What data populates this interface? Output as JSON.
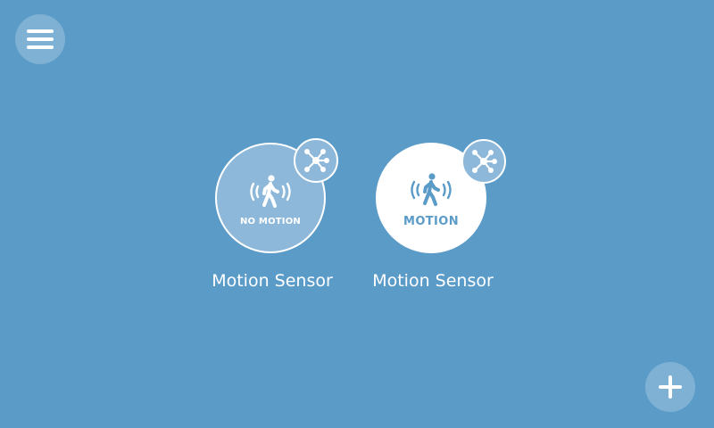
{
  "colors": {
    "background": "#5b9bc8",
    "accent": "#ffffff",
    "inactive_fill": "#8db8da"
  },
  "toolbar": {
    "menu_icon": "hamburger-menu-icon",
    "add_icon": "plus-icon"
  },
  "devices": [
    {
      "name": "Motion Sensor",
      "state_label": "NO MOTION",
      "state": "inactive",
      "icon": "walking-person-motion-icon",
      "badge_icon": "network-hub-icon"
    },
    {
      "name": "Motion Sensor",
      "state_label": "MOTION",
      "state": "active",
      "icon": "walking-person-motion-icon",
      "badge_icon": "network-hub-icon"
    }
  ]
}
